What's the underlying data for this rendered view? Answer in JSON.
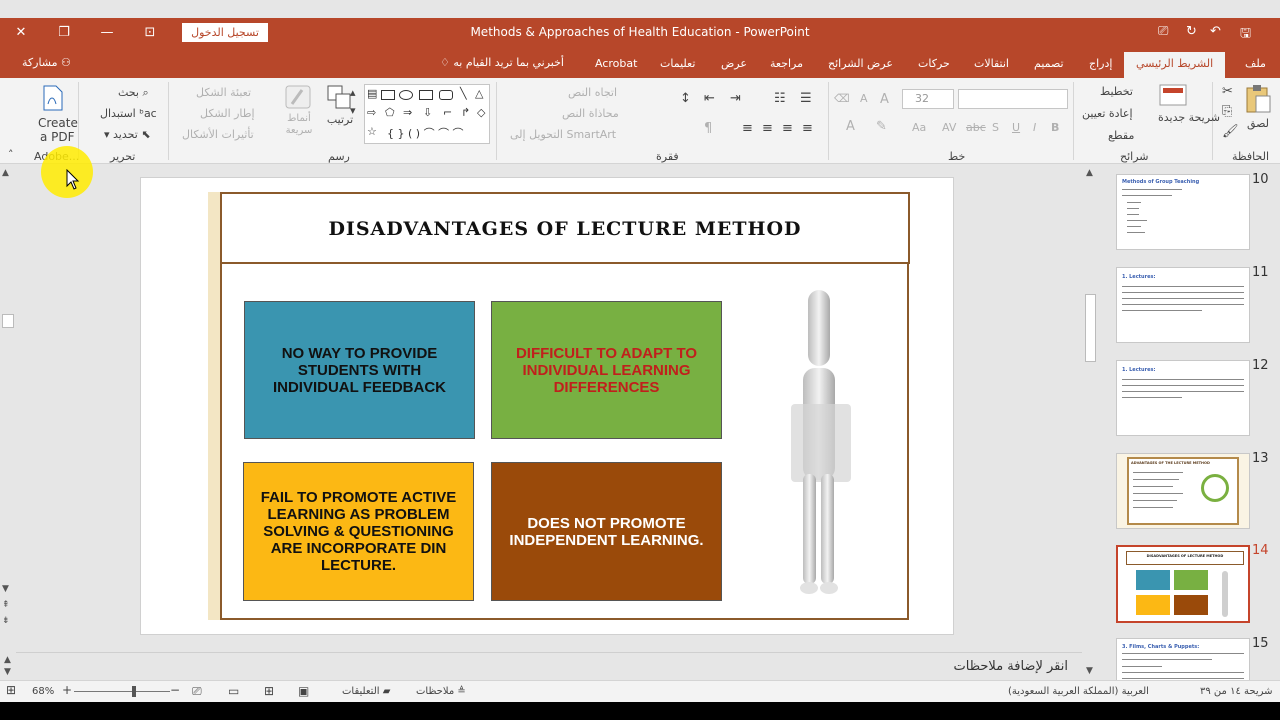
{
  "window": {
    "title": "Methods & Approaches of Health Education  -  PowerPoint",
    "sign_in": "تسجيل الدخول"
  },
  "tabs": {
    "file": "ملف",
    "home": "الشريط الرئيسي",
    "insert": "إدراج",
    "design": "تصميم",
    "transitions": "انتقالات",
    "animations": "حركات",
    "slideshow": "عرض الشرائح",
    "review": "مراجعة",
    "view": "عرض",
    "help": "تعليمات",
    "acrobat": "Acrobat",
    "tell_me": "أخبرني بما تريد القيام به",
    "share": "مشاركة"
  },
  "ribbon": {
    "clipboard": {
      "label": "الحافظة",
      "paste": "لصق"
    },
    "slides": {
      "label": "شرائح",
      "new_slide": "شريحة جديدة",
      "layout": "تخطيط",
      "reset": "إعادة تعيين",
      "section": "مقطع"
    },
    "font": {
      "label": "خط",
      "size": "32",
      "bold": "B",
      "italic": "I",
      "underline": "U",
      "shadow": "S",
      "strike": "abc",
      "grow": "A",
      "case": "Aa"
    },
    "paragraph": {
      "label": "فقرة",
      "text_direction": "اتجاه النص",
      "align_text": "محاذاة النص",
      "smartart": "التحويل إلى SmartArt"
    },
    "drawing": {
      "label": "رسم",
      "arrange": "ترتيب",
      "quick_styles": "أنماط سريعة",
      "shape_fill": "تعبئة الشكل",
      "shape_outline": "إطار الشكل",
      "shape_effects": "تأثيرات الأشكال"
    },
    "editing": {
      "label": "تحرير",
      "find": "بحث",
      "replace": "استبدال",
      "select": "تحديد"
    },
    "adobe": {
      "label": "Adobe...",
      "create_pdf_1": "Create",
      "create_pdf_2": "a PDF"
    }
  },
  "slide": {
    "title": "DISADVANTAGES OF LECTURE METHOD",
    "cards": [
      {
        "text": "NO WAY TO PROVIDE STUDENTS WITH INDIVIDUAL FEEDBACK",
        "bg": "#3a95b0",
        "color": "#111111"
      },
      {
        "text": "DIFFICULT TO ADAPT TO INDIVIDUAL LEARNING DIFFERENCES",
        "bg": "#78b042",
        "color": "#c0201c"
      },
      {
        "text": "FAIL TO PROMOTE ACTIVE LEARNING AS PROBLEM SOLVING & QUESTIONING ARE INCORPORATE DIN LECTURE.",
        "bg": "#fcb814",
        "color": "#111111"
      },
      {
        "text": "DOES NOT PROMOTE INDEPENDENT LEARNING.",
        "bg": "#9a4a0a",
        "color": "#ffffff"
      }
    ]
  },
  "thumbnails": [
    {
      "num": "10",
      "title": "Methods of Group Teaching",
      "title_color": "#3a5fb0"
    },
    {
      "num": "11",
      "title": "1.   Lectures:",
      "title_color": "#3a5fb0"
    },
    {
      "num": "12",
      "title": "1.   Lectures:",
      "title_color": "#3a5fb0"
    },
    {
      "num": "13",
      "title": "ADVANTAGES OF THE LECTURE METHOD",
      "title_color": "#5a3a1a"
    },
    {
      "num": "14",
      "title": "DISADVANTAGES OF LECTURE METHOD",
      "title_color": "#222222"
    },
    {
      "num": "15",
      "title": "3. Films, Charts & Puppets:",
      "title_color": "#3a5fb0"
    }
  ],
  "notes": {
    "placeholder": "انقر لإضافة ملاحظات"
  },
  "status": {
    "slide_info": "شريحة ١٤ من ٣٩",
    "language": "العربية (المملكة العربية السعودية)",
    "notes": "ملاحظات",
    "comments": "التعليقات",
    "zoom": "68%"
  },
  "colors": {
    "accent": "#b7472a",
    "active_thumb": "#c5442b"
  }
}
